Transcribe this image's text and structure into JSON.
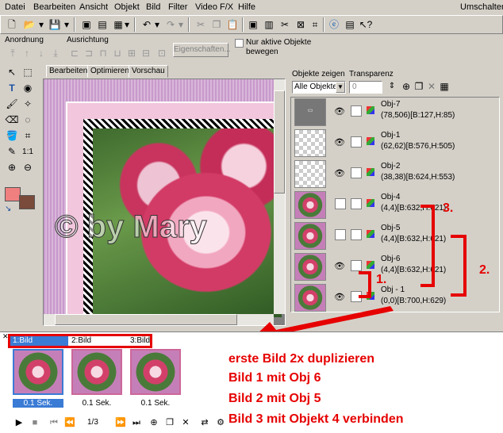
{
  "menu": {
    "items": [
      "Datei",
      "Bearbeiten",
      "Ansicht",
      "Objekt",
      "Bild",
      "Filter",
      "Video F/X",
      "Hilfe"
    ],
    "right": "Umschalten"
  },
  "align_bar": {
    "anordnung_label": "Anordnung",
    "ausrichtung_label": "Ausrichtung",
    "properties_button": "Eigenschaften...",
    "only_active_label_1": "Nur aktive Objekte",
    "only_active_label_2": "bewegen"
  },
  "tabs": [
    "Bearbeiten",
    "Optimieren",
    "Vorschau"
  ],
  "canvas": {
    "watermark": "© by Mary"
  },
  "objects_panel": {
    "show_label": "Objekte zeigen",
    "transparency_label": "Transparenz",
    "filter_value": "Alle Objekte",
    "transparency_value": "0",
    "rows": [
      {
        "name": "Obj-7",
        "dims": "(78,506)[B:127,H:85)",
        "eye": true,
        "thumb": "text"
      },
      {
        "name": "Obj-1",
        "dims": "(62,62)[B:576,H:505)",
        "eye": true,
        "thumb": "checker"
      },
      {
        "name": "Obj-2",
        "dims": "(38,38)[B:624,H:553)",
        "eye": true,
        "thumb": "checker"
      },
      {
        "name": "Obj-4",
        "dims": "(4,4)[B:632,H:621)",
        "eye": false,
        "thumb": "rose"
      },
      {
        "name": "Obj-5",
        "dims": "(4,4)[B:632,H:621)",
        "eye": false,
        "thumb": "rose"
      },
      {
        "name": "Obj-6",
        "dims": "(4,4)[B:632,H:621)",
        "eye": true,
        "thumb": "rose"
      },
      {
        "name": "Obj - 1",
        "dims": "(0,0)[B:700,H:629)",
        "eye": true,
        "thumb": "rose"
      }
    ]
  },
  "annotations": {
    "n1": "1.",
    "n2": "2.",
    "n3": "3."
  },
  "frames": {
    "tabs": [
      "1:Bild",
      "2:Bild",
      "3:Bild"
    ],
    "labels": [
      "0.1 Sek.",
      "0.1 Sek.",
      "0.1 Sek."
    ],
    "counter": "1/3"
  },
  "instructions": [
    "erste Bild 2x duplizieren",
    "Bild 1 mit Obj 6",
    "Bild 2 mit Obj 5",
    "Bild 3 mit Objekt 4 verbinden"
  ],
  "colors": {
    "accent_red": "#e60000",
    "selection_blue": "#3a7bd5"
  }
}
